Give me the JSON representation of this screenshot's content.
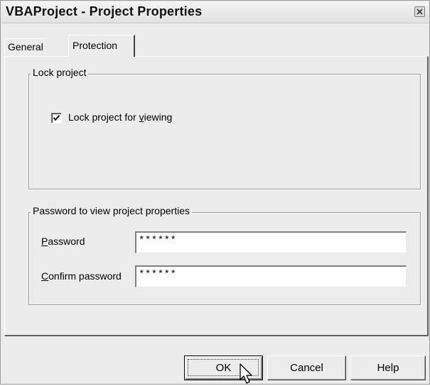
{
  "window": {
    "title": "VBAProject - Project Properties"
  },
  "tabs": [
    {
      "label": "General",
      "selected": false
    },
    {
      "label": "Protection",
      "selected": true
    }
  ],
  "lock_group": {
    "legend": "Lock project",
    "checkbox": {
      "label_before": "Lock project for ",
      "label_mnemonic": "v",
      "label_after": "iewing",
      "checked": true
    }
  },
  "password_group": {
    "legend": "Password to view project properties",
    "password": {
      "label_mnemonic": "P",
      "label_rest": "assword",
      "value": "******"
    },
    "confirm": {
      "label_mnemonic": "C",
      "label_rest": "onfirm password",
      "value": "******"
    }
  },
  "buttons": {
    "ok": "OK",
    "cancel": "Cancel",
    "help": "Help"
  },
  "icons": {
    "close": "close-icon",
    "check": "checkmark-icon",
    "cursor": "mouse-pointer-icon"
  }
}
